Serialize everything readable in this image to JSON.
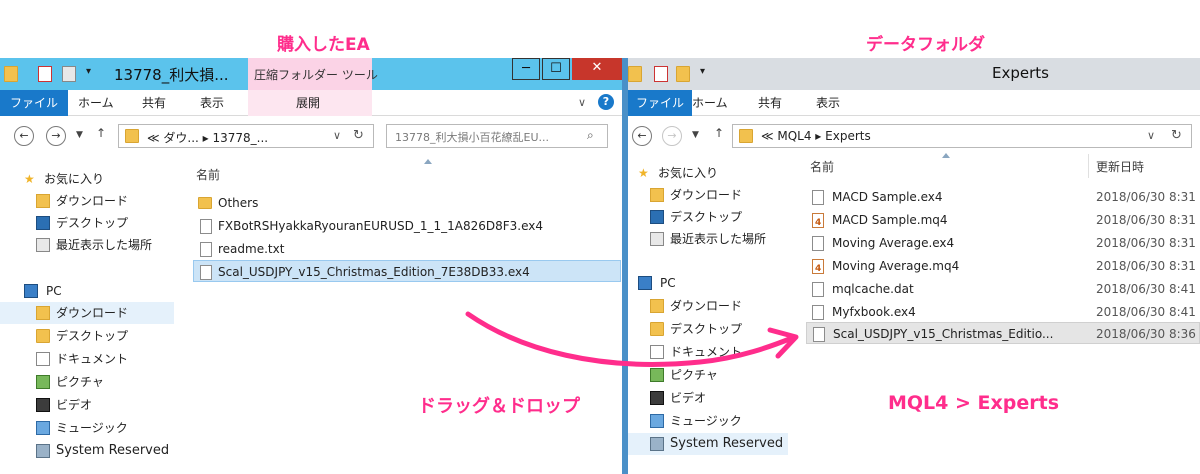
{
  "annotations": {
    "purchased_ea": "購入したEA",
    "data_folder": "データフォルダ",
    "drag_drop": "ドラッグ＆ドロップ",
    "mql4_experts": "MQL4 > Experts"
  },
  "colors": {
    "accent": "#ff2d8c",
    "ribbon_file": "#1979ca",
    "title_active": "#5bc3ec",
    "title_inactive": "#d9dde2",
    "selection": "#cce4f7"
  },
  "left_window": {
    "title": "13778_利大損...",
    "context_tab": "圧縮フォルダー ツール",
    "controls": {
      "minimize": "─",
      "maximize": "☐",
      "close": "✕"
    },
    "ribbon_tabs": [
      "ファイル",
      "ホーム",
      "共有",
      "表示",
      "展開"
    ],
    "address": "≪  ダウ... ▸ 13778_...",
    "search_placeholder": "13778_利大損小百花繚乱EU...",
    "nav_items": [
      "お気に入り",
      "ダウンロード",
      "デスクトップ",
      "最近表示した場所",
      "PC",
      "ダウンロード",
      "デスクトップ",
      "ドキュメント",
      "ピクチャ",
      "ビデオ",
      "ミュージック",
      "System Reserved"
    ],
    "column_name": "名前",
    "files": [
      "Others",
      "FXBotRSHyakkaRyouranEURUSD_1_1_1A826D8F3.ex4",
      "readme.txt",
      "Scal_USDJPY_v15_Christmas_Edition_7E38DB33.ex4"
    ]
  },
  "right_window": {
    "title": "Experts",
    "ribbon_tabs": [
      "ファイル",
      "ホーム",
      "共有",
      "表示"
    ],
    "address": "≪  MQL4  ▸  Experts",
    "nav_items": [
      "お気に入り",
      "ダウンロード",
      "デスクトップ",
      "最近表示した場所",
      "PC",
      "ダウンロード",
      "デスクトップ",
      "ドキュメント",
      "ピクチャ",
      "ビデオ",
      "ミュージック",
      "System Reserved"
    ],
    "column_name": "名前",
    "column_date": "更新日時",
    "files": [
      {
        "name": "MACD Sample.ex4",
        "date": "2018/06/30 8:31"
      },
      {
        "name": "MACD Sample.mq4",
        "date": "2018/06/30 8:31"
      },
      {
        "name": "Moving Average.ex4",
        "date": "2018/06/30 8:31"
      },
      {
        "name": "Moving Average.mq4",
        "date": "2018/06/30 8:31"
      },
      {
        "name": "mqlcache.dat",
        "date": "2018/06/30 8:41"
      },
      {
        "name": "Myfxbook.ex4",
        "date": "2018/06/30 8:41"
      },
      {
        "name": "Scal_USDJPY_v15_Christmas_Editio...",
        "date": "2018/06/30 8:36"
      }
    ]
  }
}
